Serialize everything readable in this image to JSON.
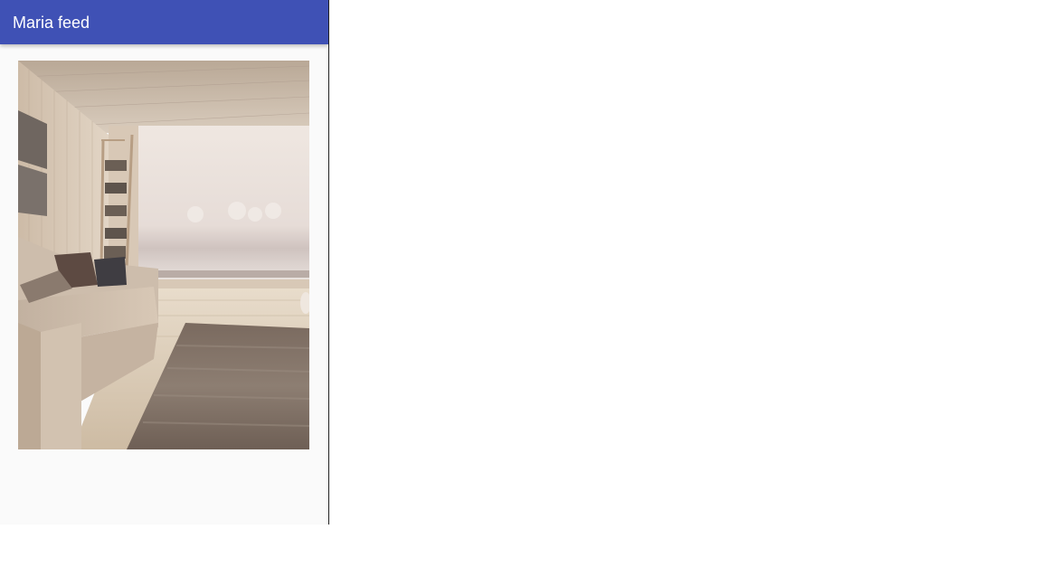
{
  "app_bar": {
    "title": "Maria feed"
  },
  "colors": {
    "app_bar": "#3f51b5",
    "app_bar_text": "#ffffff",
    "background": "#fafafa"
  },
  "feed": {
    "items": [
      {
        "type": "photo",
        "subject": "living-room-interior"
      }
    ]
  }
}
